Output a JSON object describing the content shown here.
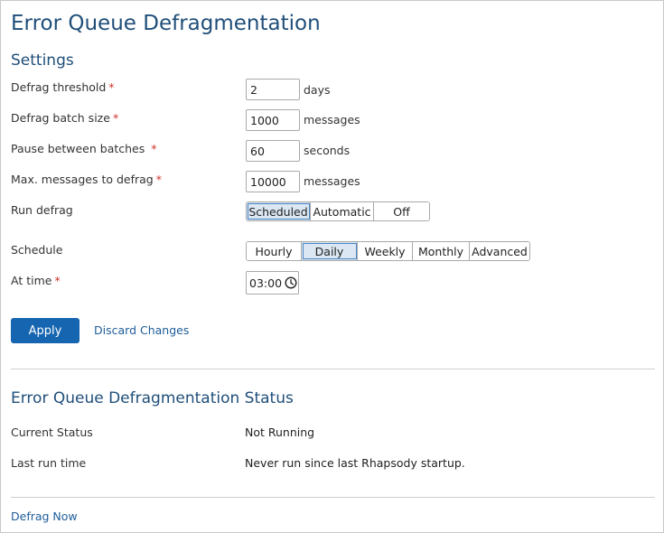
{
  "page": {
    "title": "Error Queue Defragmentation"
  },
  "settings": {
    "section_title": "Settings",
    "required_mark": "*",
    "defrag_threshold": {
      "label": "Defrag threshold",
      "value": "2",
      "unit": "days"
    },
    "defrag_batch_size": {
      "label": "Defrag batch size",
      "value": "1000",
      "unit": "messages"
    },
    "pause_between_batches": {
      "label": "Pause between batches",
      "value": "60",
      "unit": "seconds"
    },
    "max_messages": {
      "label": "Max. messages to defrag",
      "value": "10000",
      "unit": "messages"
    },
    "run_defrag": {
      "label": "Run defrag",
      "options": [
        "Scheduled",
        "Automatic",
        "Off"
      ],
      "selected": "Scheduled"
    },
    "schedule": {
      "label": "Schedule",
      "options": [
        "Hourly",
        "Daily",
        "Weekly",
        "Monthly",
        "Advanced"
      ],
      "selected": "Daily"
    },
    "at_time": {
      "label": "At time",
      "value": "03:00",
      "icon": "clock-icon"
    }
  },
  "actions": {
    "apply_label": "Apply",
    "discard_label": "Discard Changes"
  },
  "status": {
    "section_title": "Error Queue Defragmentation Status",
    "current_status_label": "Current Status",
    "current_status_value": "Not Running",
    "last_run_label": "Last run time",
    "last_run_value": "Never run since last Rhapsody startup."
  },
  "footer": {
    "defrag_now_label": "Defrag Now"
  },
  "colors": {
    "accent": "#1565b0",
    "title": "#1f4e79",
    "required": "#d0342c",
    "selected_segment": "#dbe7f3"
  }
}
